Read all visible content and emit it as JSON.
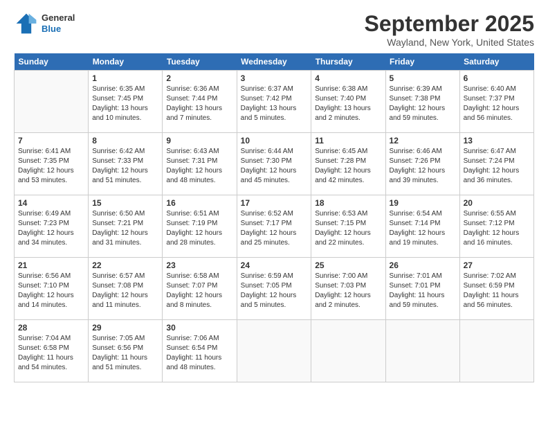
{
  "header": {
    "logo": {
      "general": "General",
      "blue": "Blue"
    },
    "title": "September 2025",
    "location": "Wayland, New York, United States"
  },
  "calendar": {
    "days_of_week": [
      "Sunday",
      "Monday",
      "Tuesday",
      "Wednesday",
      "Thursday",
      "Friday",
      "Saturday"
    ],
    "weeks": [
      [
        {
          "day": "",
          "info": ""
        },
        {
          "day": "1",
          "info": "Sunrise: 6:35 AM\nSunset: 7:45 PM\nDaylight: 13 hours\nand 10 minutes."
        },
        {
          "day": "2",
          "info": "Sunrise: 6:36 AM\nSunset: 7:44 PM\nDaylight: 13 hours\nand 7 minutes."
        },
        {
          "day": "3",
          "info": "Sunrise: 6:37 AM\nSunset: 7:42 PM\nDaylight: 13 hours\nand 5 minutes."
        },
        {
          "day": "4",
          "info": "Sunrise: 6:38 AM\nSunset: 7:40 PM\nDaylight: 13 hours\nand 2 minutes."
        },
        {
          "day": "5",
          "info": "Sunrise: 6:39 AM\nSunset: 7:38 PM\nDaylight: 12 hours\nand 59 minutes."
        },
        {
          "day": "6",
          "info": "Sunrise: 6:40 AM\nSunset: 7:37 PM\nDaylight: 12 hours\nand 56 minutes."
        }
      ],
      [
        {
          "day": "7",
          "info": "Sunrise: 6:41 AM\nSunset: 7:35 PM\nDaylight: 12 hours\nand 53 minutes."
        },
        {
          "day": "8",
          "info": "Sunrise: 6:42 AM\nSunset: 7:33 PM\nDaylight: 12 hours\nand 51 minutes."
        },
        {
          "day": "9",
          "info": "Sunrise: 6:43 AM\nSunset: 7:31 PM\nDaylight: 12 hours\nand 48 minutes."
        },
        {
          "day": "10",
          "info": "Sunrise: 6:44 AM\nSunset: 7:30 PM\nDaylight: 12 hours\nand 45 minutes."
        },
        {
          "day": "11",
          "info": "Sunrise: 6:45 AM\nSunset: 7:28 PM\nDaylight: 12 hours\nand 42 minutes."
        },
        {
          "day": "12",
          "info": "Sunrise: 6:46 AM\nSunset: 7:26 PM\nDaylight: 12 hours\nand 39 minutes."
        },
        {
          "day": "13",
          "info": "Sunrise: 6:47 AM\nSunset: 7:24 PM\nDaylight: 12 hours\nand 36 minutes."
        }
      ],
      [
        {
          "day": "14",
          "info": "Sunrise: 6:49 AM\nSunset: 7:23 PM\nDaylight: 12 hours\nand 34 minutes."
        },
        {
          "day": "15",
          "info": "Sunrise: 6:50 AM\nSunset: 7:21 PM\nDaylight: 12 hours\nand 31 minutes."
        },
        {
          "day": "16",
          "info": "Sunrise: 6:51 AM\nSunset: 7:19 PM\nDaylight: 12 hours\nand 28 minutes."
        },
        {
          "day": "17",
          "info": "Sunrise: 6:52 AM\nSunset: 7:17 PM\nDaylight: 12 hours\nand 25 minutes."
        },
        {
          "day": "18",
          "info": "Sunrise: 6:53 AM\nSunset: 7:15 PM\nDaylight: 12 hours\nand 22 minutes."
        },
        {
          "day": "19",
          "info": "Sunrise: 6:54 AM\nSunset: 7:14 PM\nDaylight: 12 hours\nand 19 minutes."
        },
        {
          "day": "20",
          "info": "Sunrise: 6:55 AM\nSunset: 7:12 PM\nDaylight: 12 hours\nand 16 minutes."
        }
      ],
      [
        {
          "day": "21",
          "info": "Sunrise: 6:56 AM\nSunset: 7:10 PM\nDaylight: 12 hours\nand 14 minutes."
        },
        {
          "day": "22",
          "info": "Sunrise: 6:57 AM\nSunset: 7:08 PM\nDaylight: 12 hours\nand 11 minutes."
        },
        {
          "day": "23",
          "info": "Sunrise: 6:58 AM\nSunset: 7:07 PM\nDaylight: 12 hours\nand 8 minutes."
        },
        {
          "day": "24",
          "info": "Sunrise: 6:59 AM\nSunset: 7:05 PM\nDaylight: 12 hours\nand 5 minutes."
        },
        {
          "day": "25",
          "info": "Sunrise: 7:00 AM\nSunset: 7:03 PM\nDaylight: 12 hours\nand 2 minutes."
        },
        {
          "day": "26",
          "info": "Sunrise: 7:01 AM\nSunset: 7:01 PM\nDaylight: 11 hours\nand 59 minutes."
        },
        {
          "day": "27",
          "info": "Sunrise: 7:02 AM\nSunset: 6:59 PM\nDaylight: 11 hours\nand 56 minutes."
        }
      ],
      [
        {
          "day": "28",
          "info": "Sunrise: 7:04 AM\nSunset: 6:58 PM\nDaylight: 11 hours\nand 54 minutes."
        },
        {
          "day": "29",
          "info": "Sunrise: 7:05 AM\nSunset: 6:56 PM\nDaylight: 11 hours\nand 51 minutes."
        },
        {
          "day": "30",
          "info": "Sunrise: 7:06 AM\nSunset: 6:54 PM\nDaylight: 11 hours\nand 48 minutes."
        },
        {
          "day": "",
          "info": ""
        },
        {
          "day": "",
          "info": ""
        },
        {
          "day": "",
          "info": ""
        },
        {
          "day": "",
          "info": ""
        }
      ]
    ]
  }
}
